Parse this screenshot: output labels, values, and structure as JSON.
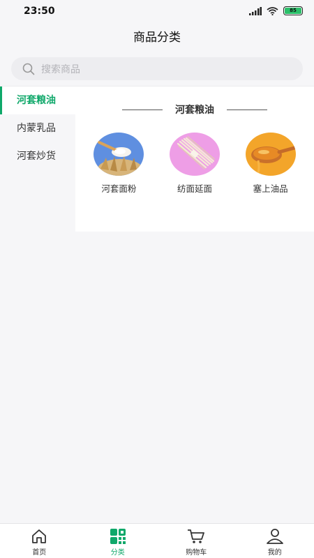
{
  "status": {
    "time": "23:50",
    "battery": "85"
  },
  "nav": {
    "title": "商品分类"
  },
  "search": {
    "placeholder": "搜索商品"
  },
  "sidebar": {
    "items": [
      {
        "label": "河套粮油",
        "active": true
      },
      {
        "label": "内蒙乳品",
        "active": false
      },
      {
        "label": "河套炒货",
        "active": false
      }
    ]
  },
  "section": {
    "title": "河套粮油",
    "items": [
      {
        "label": "河套面粉",
        "icon": "flour-image"
      },
      {
        "label": "纺面延面",
        "icon": "noodles-image"
      },
      {
        "label": "塞上油品",
        "icon": "oil-image"
      }
    ]
  },
  "tabbar": {
    "tabs": [
      {
        "label": "首页",
        "icon": "home-icon",
        "active": false
      },
      {
        "label": "分类",
        "icon": "category-icon",
        "active": true
      },
      {
        "label": "购物车",
        "icon": "cart-icon",
        "active": false
      },
      {
        "label": "我的",
        "icon": "profile-icon",
        "active": false
      }
    ]
  },
  "colors": {
    "accent": "#0fa86a"
  }
}
